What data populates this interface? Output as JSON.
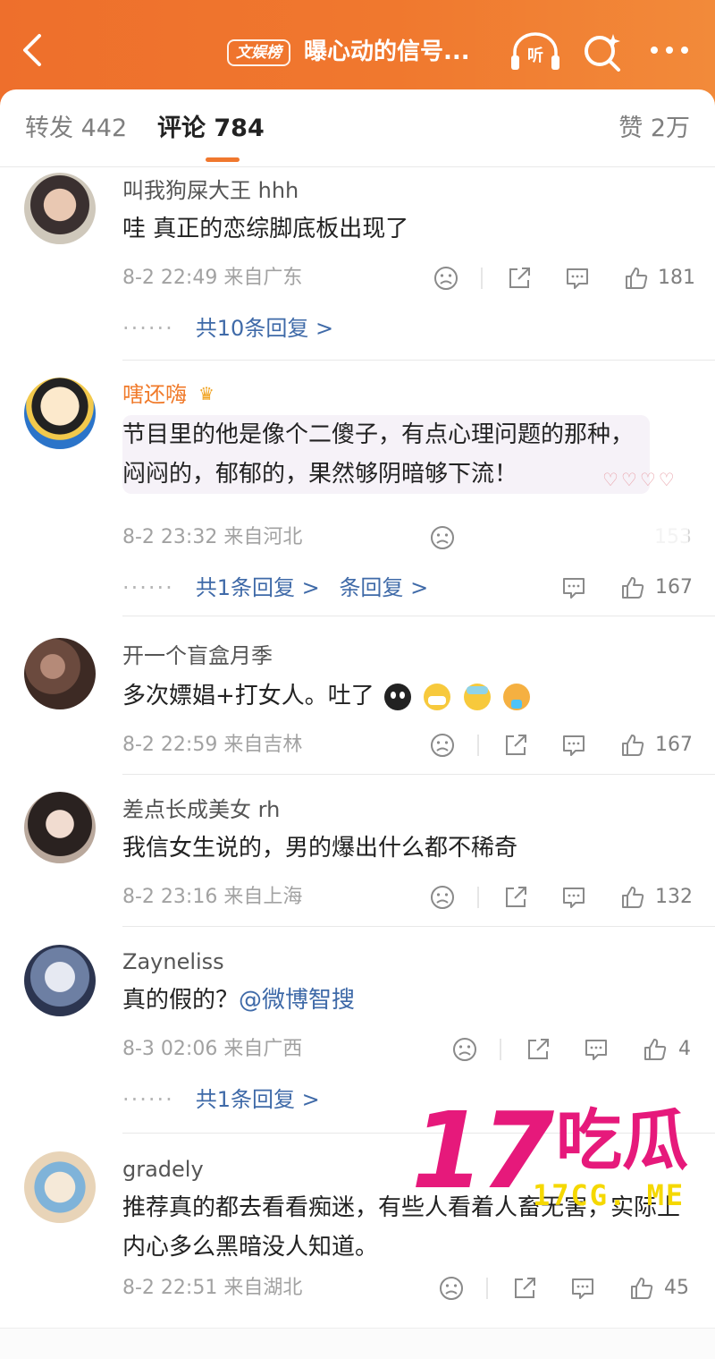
{
  "header": {
    "back_icon": "chevron-left-icon",
    "badge": "文娱榜",
    "title": "曝心动的信号...",
    "listen_label": "听",
    "search_icon": "search-sparkle-icon",
    "more_icon": "more-dots-icon"
  },
  "tabs": {
    "repost": "转发 442",
    "comment": "评论 784",
    "like": "赞 2万"
  },
  "comments": [
    {
      "user": "叫我狗屎大王 hhh",
      "text": "哇 真正的恋综脚底板出现了",
      "meta": "8-2 22:49 来自广东",
      "likes": "181",
      "replies": "共10条回复 >"
    },
    {
      "user": "嗐还嗨",
      "crown": "♛",
      "text": "节目里的他是像个二傻子，有点心理问题的那种，闷闷的，郁郁的，果然够阴暗够下流！",
      "meta": "8-2 23:32 来自河北",
      "likes": "167",
      "likes_ghost": "153",
      "replies": "共1条回复 >",
      "replies_ghost": "条回复 >"
    },
    {
      "user": "开一个盲盒月季",
      "text": "多次嫖娼+打女人。吐了",
      "meta": "8-2 22:59 来自吉林",
      "likes": "167"
    },
    {
      "user": "差点长成美女 rh",
      "text": "我信女生说的，男的爆出什么都不稀奇",
      "meta": "8-2 23:16 来自上海",
      "likes": "132"
    },
    {
      "user": "Zayneliss",
      "text": "真的假的？",
      "mention": "@微博智搜",
      "meta": "8-3 02:06 来自广西",
      "likes": "4",
      "replies": "共1条回复 >"
    },
    {
      "user": "gradely",
      "text": "推荐真的都去看看痴迷，有些人看着人畜无害，实际上内心多么黑暗没人知道。",
      "meta": "8-2 22:51 来自湖北",
      "likes": "45"
    }
  ],
  "watermark": {
    "number": "17",
    "cn": "吃瓜",
    "url": "17CG. ME"
  },
  "colors": {
    "accent": "#f0782e",
    "link": "#3f6aa8",
    "watermark": "#e6197b"
  }
}
